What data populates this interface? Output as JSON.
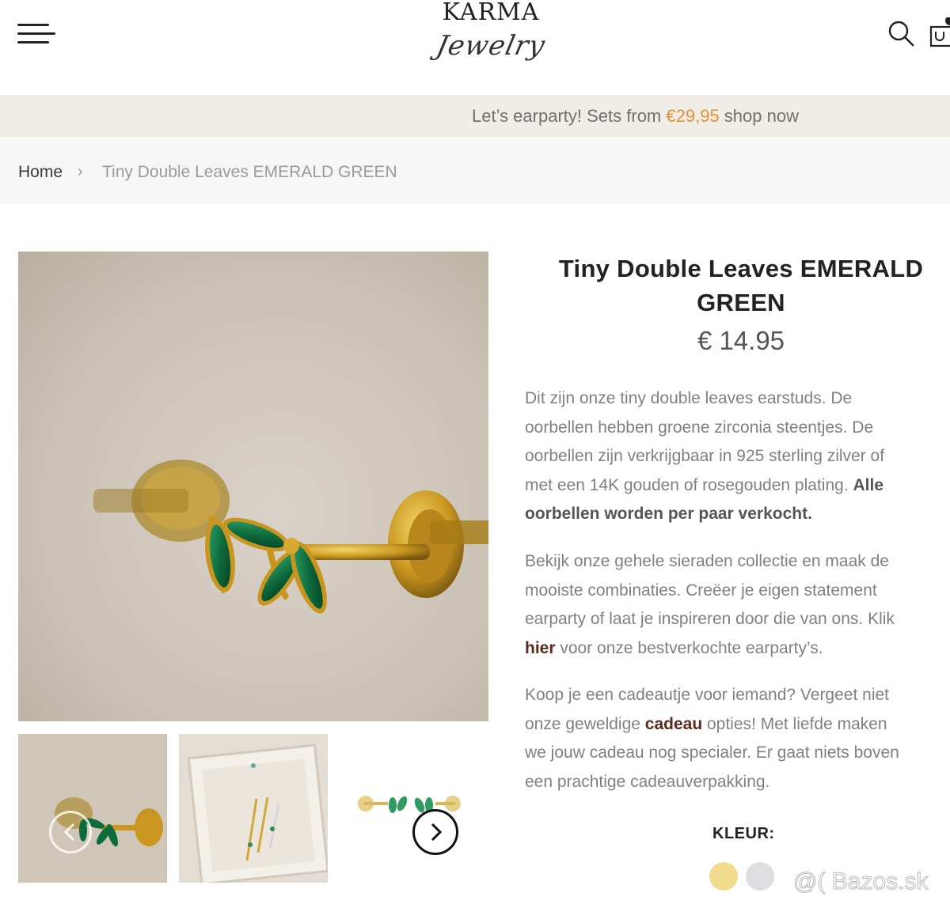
{
  "header": {
    "logo_main": "KARMA",
    "logo_script": "Jewelry",
    "menu_icon": "hamburger-icon",
    "search_icon": "search-icon",
    "cart_icon": "cart-icon"
  },
  "promo": {
    "text_before": "Let’s earparty! Sets from ",
    "price": "€29,95",
    "text_after": " shop now",
    "price_color": "#e39133"
  },
  "breadcrumb": {
    "home": "Home",
    "separator": "›",
    "current": "Tiny Double Leaves EMERALD GREEN"
  },
  "product": {
    "title": "Tiny Double Leaves EMERALD GREEN",
    "price": "€ 14.95",
    "description": {
      "p1_lines": [
        "Dit zijn onze tiny double leaves earstuds. De",
        "oorbellen hebben groene zirconia steentjes. De",
        "oorbellen zijn verkrijgbaar in 925 sterling zilver of",
        "met een 14K gouden of rosegouden plating. "
      ],
      "p1_bold_a": "Alle",
      "p1_bold_b": "oorbellen worden per paar verkocht.",
      "p2_lines": [
        "Bekijk onze gehele sieraden collectie en maak de",
        "mooiste combinaties. Creëer je eigen statement",
        "earparty of laat je inspireren door die van ons. Klik"
      ],
      "p2_link": "hier",
      "p2_after": " voor onze bestverkochte earparty’s.",
      "p3_line1": "Koop je een cadeautje voor iemand? Vergeet niet",
      "p3_before": "onze geweldige ",
      "p3_link": "cadeau",
      "p3_after": " opties! Met liefde maken",
      "p3_line3": "we jouw cadeau nog specialer. Er gaat niets boven",
      "p3_line4": "een prachtige cadeauverpakking."
    },
    "color_label": "KLEUR:",
    "swatches": [
      {
        "name": "gold",
        "color": "#f0dc8c"
      },
      {
        "name": "silver",
        "color": "#dedee0"
      }
    ]
  },
  "gallery": {
    "prev_icon": "chevron-left-icon",
    "next_icon": "chevron-right-icon"
  },
  "watermark": "@( Bazos.sk"
}
